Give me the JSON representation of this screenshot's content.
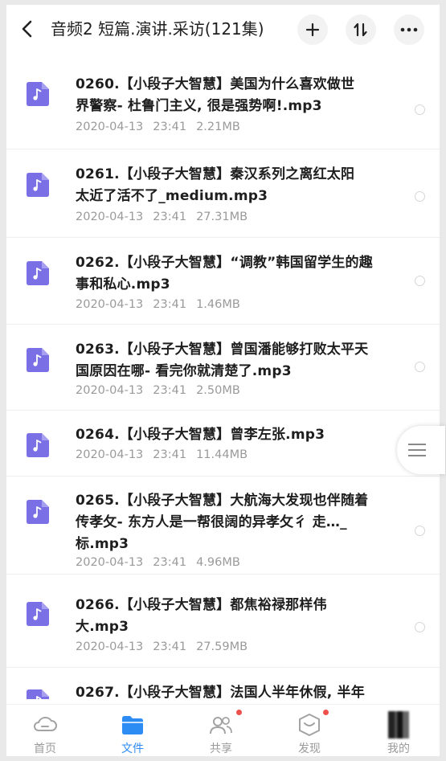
{
  "header": {
    "title": "音频2 短篇.演讲.采访(121集)",
    "back_icon": "chevron-left-icon",
    "add_icon": "plus-icon",
    "sort_icon": "sort-icon",
    "more_icon": "more-horizontal-icon"
  },
  "files": [
    {
      "line1": "0260.【小段子大智慧】美国为什么喜欢做世",
      "line2": "界警察- 杜鲁门主义, 很是强势啊!.mp3",
      "line3": "",
      "date": "2020-04-13",
      "time": "23:41",
      "size": "2.21MB"
    },
    {
      "line1": "0261.【小段子大智慧】秦汉系列之离红太阳",
      "line2": "太近了活不了_medium.mp3",
      "line3": "",
      "date": "2020-04-13",
      "time": "23:41",
      "size": "27.31MB"
    },
    {
      "line1": "0262.【小段子大智慧】“调教”韩国留学生的趣",
      "line2": "事和私心.mp3",
      "line3": "",
      "date": "2020-04-13",
      "time": "23:41",
      "size": "1.46MB"
    },
    {
      "line1": "0263.【小段子大智慧】曾国潘能够打败太平天",
      "line2": "国原因在哪- 看完你就清楚了.mp3",
      "line3": "",
      "date": "2020-04-13",
      "time": "23:41",
      "size": "2.50MB"
    },
    {
      "line1": "0264.【小段子大智慧】曾李左张.mp3",
      "line2": "",
      "line3": "",
      "date": "2020-04-13",
      "time": "23:41",
      "size": "11.44MB"
    },
    {
      "line1": "0265.【小段子大智慧】大航海大发现也伴随着",
      "line2": "传孝攵- 东方人是一帮很阔的异孝攵彳 走…_",
      "line3": "标.mp3",
      "date": "2020-04-13",
      "time": "23:41",
      "size": "4.96MB"
    },
    {
      "line1": "0266.【小段子大智慧】都焦裕禄那样伟",
      "line2": "大.mp3",
      "line3": "",
      "date": "2020-04-13",
      "time": "23:41",
      "size": "27.59MB"
    },
    {
      "line1": "0267.【小段子大智慧】法国人半年休假, 半年",
      "line2": "",
      "line3": "",
      "date": "",
      "time": "",
      "size": ""
    }
  ],
  "tabs": [
    {
      "label": "首页",
      "icon": "cloud-icon"
    },
    {
      "label": "文件",
      "icon": "folder-icon"
    },
    {
      "label": "共享",
      "icon": "people-icon"
    },
    {
      "label": "发现",
      "icon": "cube-icon"
    },
    {
      "label": "我的",
      "icon": "avatar-icon"
    }
  ],
  "colors": {
    "accent": "#2c8cf4",
    "file_icon": "#7b6fe6",
    "badge": "#f0504c"
  }
}
